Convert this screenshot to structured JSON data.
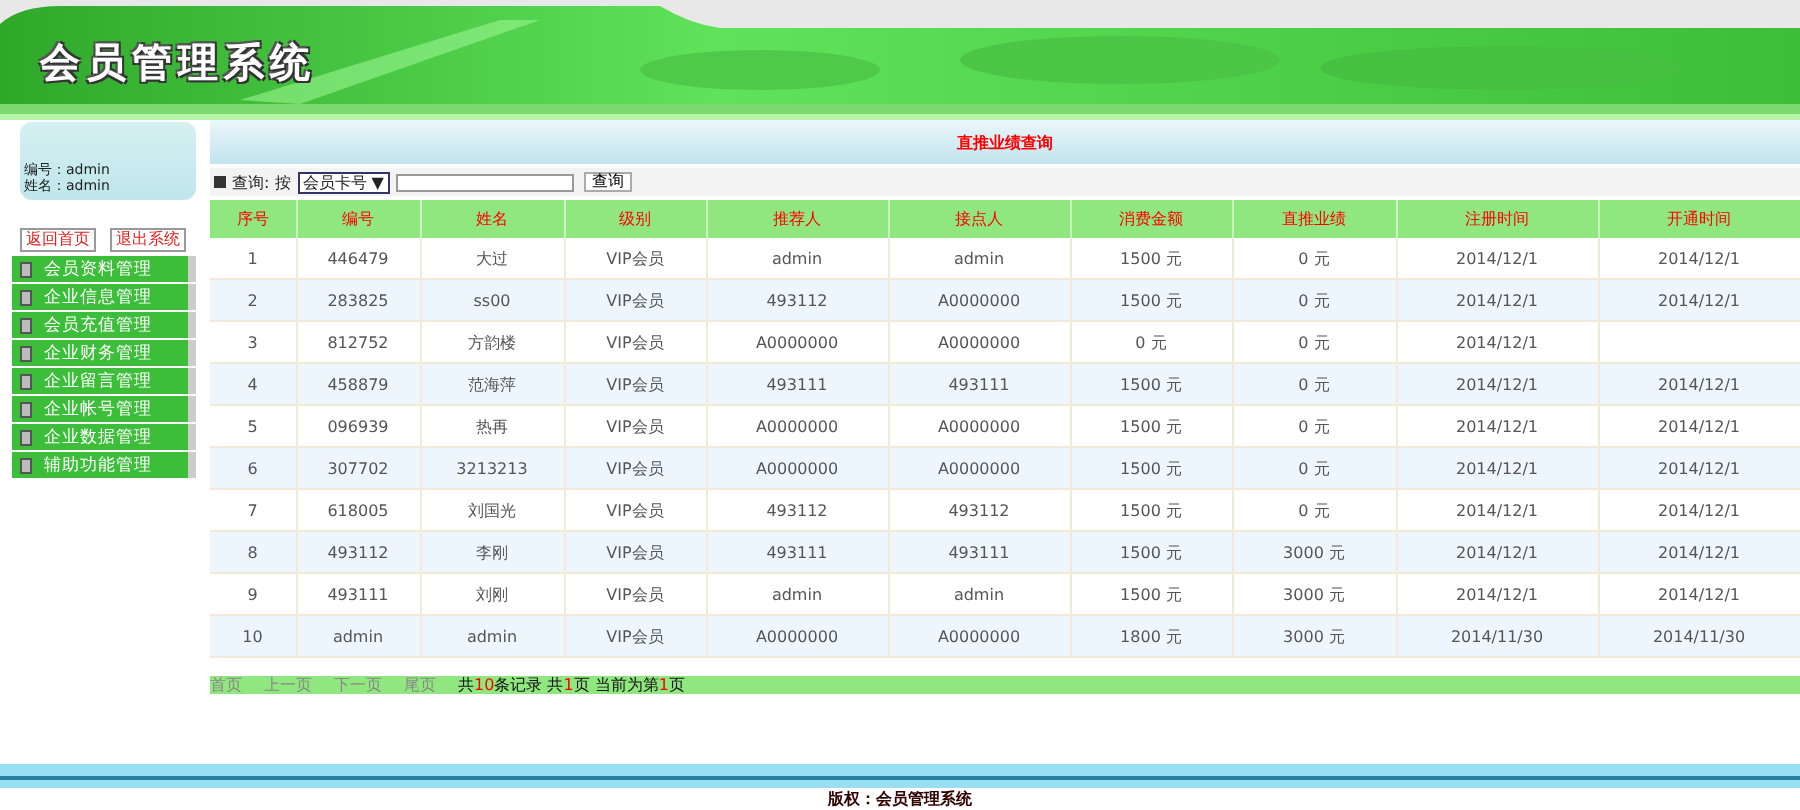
{
  "header": {
    "title": "会员管理系统"
  },
  "sidebar": {
    "user": [
      {
        "label": "编号：",
        "value": "admin"
      },
      {
        "label": "姓名：",
        "value": "admin"
      }
    ],
    "buttons": [
      "返回首页",
      "退出系统"
    ],
    "menu": [
      {
        "label": "会员资料管理"
      },
      {
        "label": "企业信息管理"
      },
      {
        "label": "会员充值管理"
      },
      {
        "label": "企业财务管理"
      },
      {
        "label": "企业留言管理"
      },
      {
        "label": "企业帐号管理"
      },
      {
        "label": "企业数据管理"
      },
      {
        "label": "辅助功能管理"
      }
    ]
  },
  "page_title": "直推业绩查询",
  "query": {
    "label": "查询:",
    "by": "按",
    "field": "会员卡号",
    "caret": "▼",
    "button": "查询"
  },
  "table": {
    "columns": [
      "序号",
      "编号",
      "姓名",
      "级别",
      "推荐人",
      "接点人",
      "消费金额",
      "直推业绩",
      "注册时间",
      "开通时间"
    ],
    "rows": [
      [
        "1",
        "446479",
        "大过",
        "VIP会员",
        "admin",
        "admin",
        "1500 元",
        "0 元",
        "2014/12/1",
        "2014/12/1"
      ],
      [
        "2",
        "283825",
        "ss00",
        "VIP会员",
        "493112",
        "A0000000",
        "1500 元",
        "0 元",
        "2014/12/1",
        "2014/12/1"
      ],
      [
        "3",
        "812752",
        "方韵楼",
        "VIP会员",
        "A0000000",
        "A0000000",
        "0 元",
        "0 元",
        "2014/12/1",
        ""
      ],
      [
        "4",
        "458879",
        "范海萍",
        "VIP会员",
        "493111",
        "493111",
        "1500 元",
        "0 元",
        "2014/12/1",
        "2014/12/1"
      ],
      [
        "5",
        "096939",
        "热再",
        "VIP会员",
        "A0000000",
        "A0000000",
        "1500 元",
        "0 元",
        "2014/12/1",
        "2014/12/1"
      ],
      [
        "6",
        "307702",
        "3213213",
        "VIP会员",
        "A0000000",
        "A0000000",
        "1500 元",
        "0 元",
        "2014/12/1",
        "2014/12/1"
      ],
      [
        "7",
        "618005",
        "刘国光",
        "VIP会员",
        "493112",
        "493112",
        "1500 元",
        "0 元",
        "2014/12/1",
        "2014/12/1"
      ],
      [
        "8",
        "493112",
        "李刚",
        "VIP会员",
        "493111",
        "493111",
        "1500 元",
        "3000 元",
        "2014/12/1",
        "2014/12/1"
      ],
      [
        "9",
        "493111",
        "刘刚",
        "VIP会员",
        "admin",
        "admin",
        "1500 元",
        "3000 元",
        "2014/12/1",
        "2014/12/1"
      ],
      [
        "10",
        "admin",
        "admin",
        "VIP会员",
        "A0000000",
        "A0000000",
        "1800 元",
        "3000 元",
        "2014/11/30",
        "2014/11/30"
      ]
    ]
  },
  "pager": {
    "links": [
      {
        "label": "首页",
        "disabled": true
      },
      {
        "label": "上一页",
        "disabled": true
      },
      {
        "label": "下一页",
        "disabled": true
      },
      {
        "label": "尾页",
        "disabled": true
      }
    ],
    "summary": [
      {
        "text": "共",
        "highlight": false
      },
      {
        "text": "10",
        "highlight": true
      },
      {
        "text": "条记录 共",
        "highlight": false
      },
      {
        "text": "1",
        "highlight": true
      },
      {
        "text": "页 当前为第",
        "highlight": false
      },
      {
        "text": "1",
        "highlight": true
      },
      {
        "text": "页",
        "highlight": false
      }
    ]
  },
  "footer": {
    "copyright": "版权：会员管理系统"
  }
}
